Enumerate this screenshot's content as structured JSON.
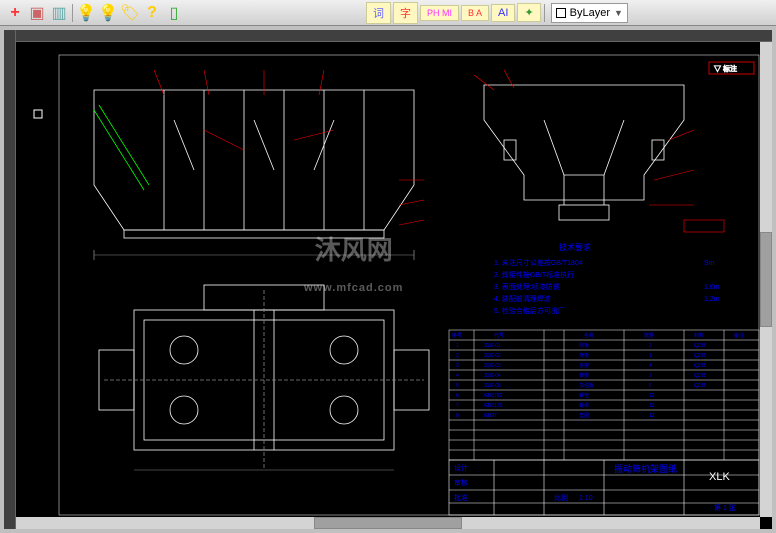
{
  "toolbar": {
    "buttons": [
      {
        "name": "plus-icon",
        "glyph": "+",
        "color": "#f33"
      },
      {
        "name": "book-icon",
        "glyph": "▣",
        "color": "#c66"
      },
      {
        "name": "sheet-icon",
        "glyph": "▥",
        "color": "#6aa"
      },
      {
        "name": "bulb-icon",
        "glyph": "💡",
        "color": "#fc0"
      },
      {
        "name": "bulb2-icon",
        "glyph": "💡",
        "color": "#fc0"
      },
      {
        "name": "tag-icon",
        "glyph": "🏷",
        "color": "#fc0"
      },
      {
        "name": "question-icon",
        "glyph": "?",
        "color": "#fc0"
      },
      {
        "name": "note-icon",
        "glyph": "▯",
        "color": "#3a3"
      }
    ],
    "labels": [
      {
        "name": "label-ci",
        "text": "词",
        "color": "#66f"
      },
      {
        "name": "label-zi",
        "text": "字",
        "color": "#f33"
      },
      {
        "name": "label-pm",
        "text": "PH MI",
        "color": "#f3f"
      },
      {
        "name": "label-ba",
        "text": "B A",
        "color": "#f33"
      },
      {
        "name": "label-ai",
        "text": "AI",
        "color": "#33f"
      },
      {
        "name": "label-star",
        "text": "✦",
        "color": "#393"
      }
    ],
    "layer": {
      "label": "ByLayer"
    }
  },
  "drawing": {
    "border_color": "#ff0000",
    "geometry_color": "#ffffff",
    "text_color": "#0000ff",
    "annotation_color": "#ff0000",
    "watermark": "沐风网",
    "watermark_sub": "www.mfcad.com",
    "title_block": {
      "project": "振动筛机架图纸",
      "code": "XLK",
      "scale": "1:10"
    },
    "tech_req": {
      "heading": "技术要求",
      "items": [
        "1. 未注尺寸公差按GB/T1804",
        "2. 焊接件按GB/T标准执行",
        "3. 表面处理:喷漆防锈",
        "4. 装配前清理焊渣",
        "5. 检验合格后方可出厂"
      ],
      "specs": [
        "Sm",
        "1.0m",
        "1.2m"
      ]
    }
  }
}
